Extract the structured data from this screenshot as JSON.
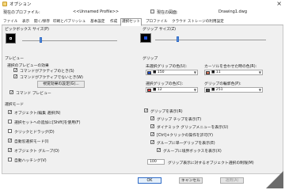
{
  "window": {
    "title": "オプション"
  },
  "profile": {
    "current_label": "現在のプロファイル:",
    "current_value": "<<Unnamed Profile>>",
    "drawing_label": "現在の図面:",
    "drawing_value": "Drawing1.dwg"
  },
  "tabs": [
    {
      "label": "ファイル"
    },
    {
      "label": "表示"
    },
    {
      "label": "開く/保存"
    },
    {
      "label": "印刷とパブリッシュ"
    },
    {
      "label": "基本設定"
    },
    {
      "label": "作成"
    },
    {
      "label": "選択セット"
    },
    {
      "label": "プロファイル"
    },
    {
      "label": "クラウド ストレージの利用設定"
    }
  ],
  "left": {
    "pickbox_label": "ピックボックス サイズ(P)",
    "preview_label": "プレビュー",
    "selection_effect_label": "選択のプレビューの効果",
    "cb_command_active": "コマンドがアクティブのとき(S)",
    "cb_no_command": "コマンドがアクティブでないとき(W)",
    "visual_effect_button": "視覚効果の設定(G)...",
    "cb_command_preview": "コマンド プレビュー",
    "selection_mode_label": "選択モード",
    "mode_items": [
      {
        "label": "オブジェクト/編集 選択(N)",
        "checked": true
      },
      {
        "label": "選択セットへの追加に[Shift]を使用(F)",
        "checked": false
      },
      {
        "label": "クリックとドラッグ(D)",
        "checked": false
      },
      {
        "label": "自動窓選択モード(I)",
        "checked": true
      },
      {
        "label": "オブジェクト グループ(O)",
        "checked": true
      },
      {
        "label": "自動ハッチング(V)",
        "checked": false
      }
    ]
  },
  "right": {
    "grip_size_label": "グリップ サイズ(Z)",
    "grip_label": "グリップ",
    "unselected_color_label": "未選択グリップの色(U):",
    "unselected_color_value": "■ 150",
    "unselected_color_hex": "#1f4fd6",
    "hover_color_label": "カーソルを合わせた時の色(R):",
    "hover_color_value": "■ 11",
    "hover_color_hex": "#e07a5f",
    "selected_color_label": "選択グリップの色(C):",
    "selected_color_value": "■ 12",
    "selected_color_hex": "#e03c3c",
    "contour_color_label": "グリップの輪郭色(P):",
    "contour_color_value": "■ 251",
    "contour_color_hex": "#595959",
    "grip_items": [
      {
        "label": "グリップを表示(R)",
        "checked": true
      },
      {
        "label": "グリップ チップを表示(T)",
        "checked": true
      },
      {
        "label": "ダイナミック グリップメニューを表示(U)",
        "checked": true
      },
      {
        "label": "[Ctrl]+クリックの操作を許可(Y)",
        "checked": true
      },
      {
        "label": "グループに単一グリップを表示(E)",
        "checked": true
      },
      {
        "label": "グループに境界ボックスを表示(X)",
        "checked": true
      }
    ],
    "limit_value": "100",
    "limit_label": "グリップ表示に対するオブジェクト選択の制限(M)"
  },
  "buttons": {
    "ok": "OK",
    "cancel": "キャンセル",
    "apply": "適用(A)"
  }
}
